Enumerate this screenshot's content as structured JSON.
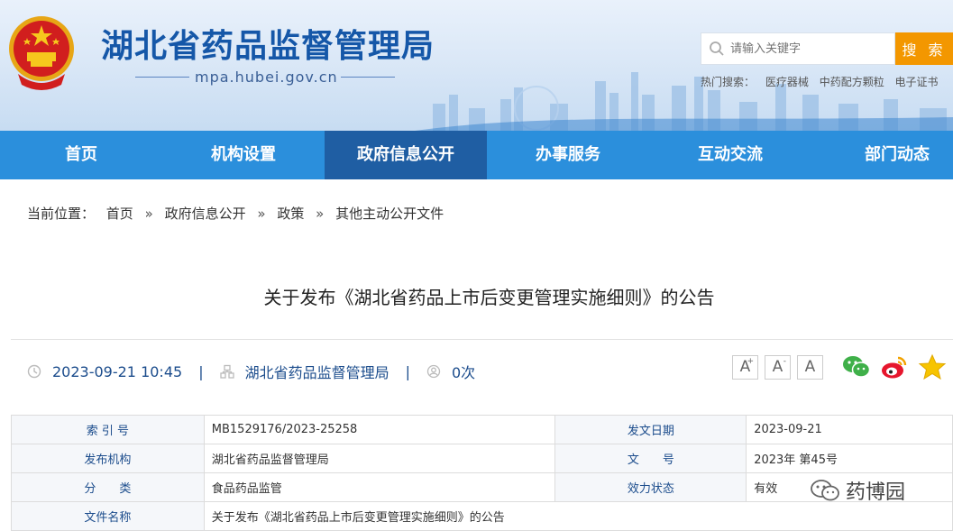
{
  "header": {
    "site_title": "湖北省药品监督管理局",
    "site_domain": "mpa.hubei.gov.cn",
    "search_placeholder": "请输入关键字",
    "search_button": "搜 索",
    "hot_label": "热门搜索：",
    "hot_items": [
      "医疗器械",
      "中药配方颗粒",
      "电子证书"
    ]
  },
  "nav": {
    "items": [
      "首页",
      "机构设置",
      "政府信息公开",
      "办事服务",
      "互动交流",
      "部门动态"
    ]
  },
  "breadcrumb": {
    "label": "当前位置：",
    "items": [
      "首页",
      "政府信息公开",
      "政策",
      "其他主动公开文件"
    ],
    "separator": "»"
  },
  "article": {
    "title": "关于发布《湖北省药品上市后变更管理实施细则》的公告",
    "datetime": "2023-09-21 10:45",
    "source": "湖北省药品监督管理局",
    "views": "0次"
  },
  "font_sizes": [
    "A+",
    "A-",
    "A"
  ],
  "info_table": {
    "rows": [
      {
        "label1": "索 引 号",
        "value1": "MB1529176/2023-25258",
        "label2": "发文日期",
        "value2": "2023-09-21"
      },
      {
        "label1": "发布机构",
        "value1": "湖北省药品监督管理局",
        "label2": "文　　号",
        "value2": "2023年 第45号"
      },
      {
        "label1": "分　　类",
        "value1": "食品药品监管",
        "label2": "效力状态",
        "value2": "有效"
      },
      {
        "label1": "文件名称",
        "value1": "关于发布《湖北省药品上市后变更管理实施细则》的公告"
      }
    ]
  },
  "watermark": "药博园",
  "colors": {
    "nav": "#2b8fdc",
    "nav_active": "#1f5ea3",
    "search_button": "#f39700",
    "title_blue": "#1557a8",
    "label_blue": "#1b4c8c"
  },
  "icons": [
    "national-emblem-icon",
    "search-icon",
    "clock-icon",
    "organization-icon",
    "user-icon",
    "wechat-icon",
    "weibo-icon",
    "star-icon",
    "watermark-wechat-icon"
  ]
}
